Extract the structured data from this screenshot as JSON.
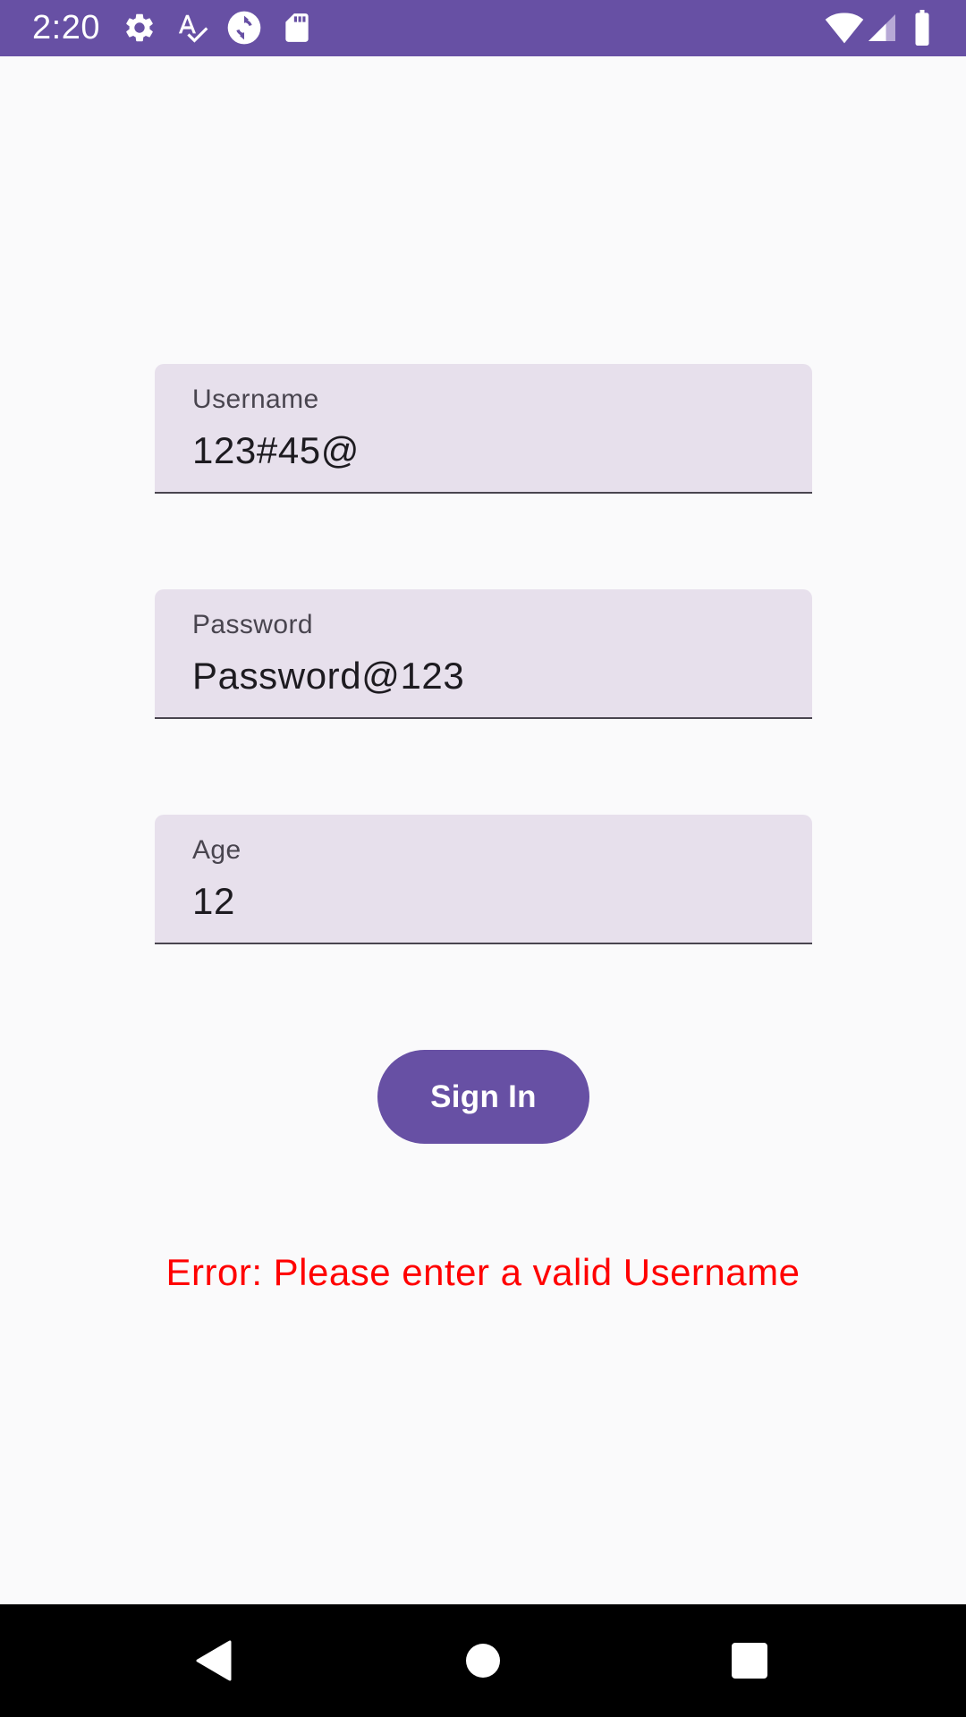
{
  "status_bar": {
    "time": "2:20",
    "background_color": "#6750A4",
    "left_icons": [
      "gear-icon",
      "text-spellcheck-icon",
      "sync-circle-icon",
      "sd-card-icon"
    ],
    "right_icons": [
      "wifi-icon",
      "cellular-signal-icon",
      "battery-icon"
    ]
  },
  "form": {
    "username": {
      "label": "Username",
      "value": "123#45@"
    },
    "password": {
      "label": "Password",
      "value": "Password@123"
    },
    "age": {
      "label": "Age",
      "value": "12"
    },
    "sign_in_label": "Sign In",
    "field_background_color": "#E7E0EC",
    "button_color": "#6750A4"
  },
  "error": {
    "text": "Error: Please enter a valid Username",
    "color": "#FF0000"
  },
  "nav_bar": {
    "buttons": [
      "back-icon",
      "home-icon",
      "recents-icon"
    ]
  }
}
